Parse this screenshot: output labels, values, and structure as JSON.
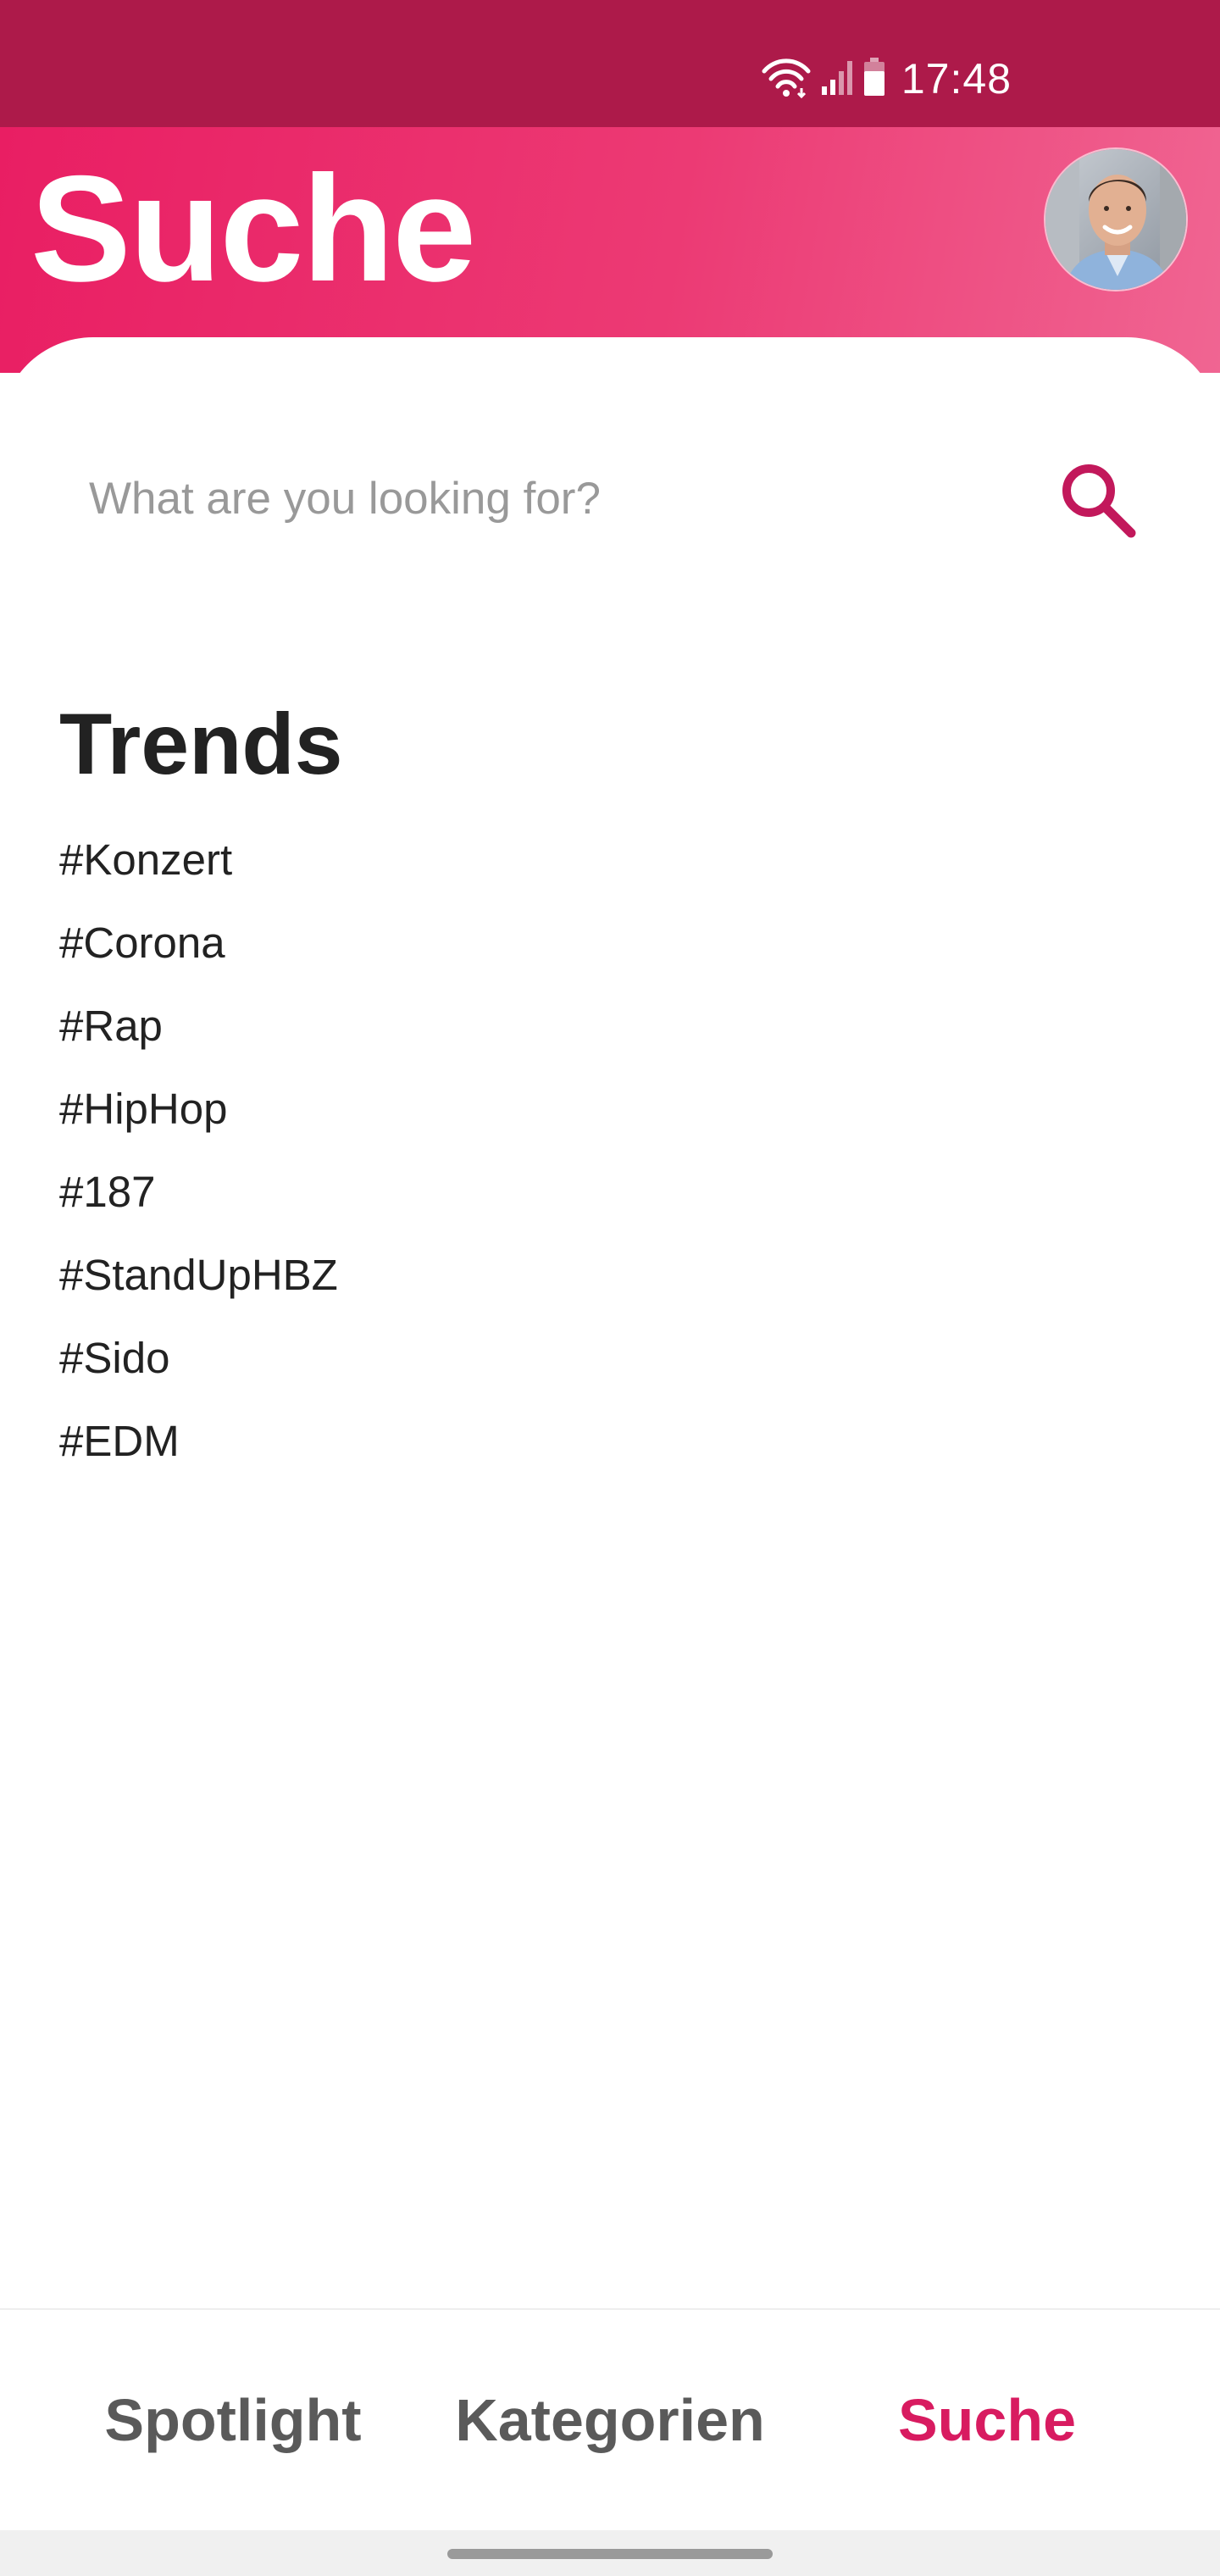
{
  "status_bar": {
    "time": "17:48",
    "icons": [
      "wifi-icon",
      "signal-icon",
      "battery-icon"
    ],
    "background": "#ad1a4a"
  },
  "header": {
    "title": "Suche",
    "avatar_icon": "user-avatar",
    "gradient_start": "#e91e63",
    "gradient_end": "#f06592"
  },
  "search": {
    "placeholder": "What are you looking for?",
    "value": "",
    "icon": "search-icon"
  },
  "trends": {
    "title": "Trends",
    "items": [
      "#Konzert",
      "#Corona",
      "#Rap",
      "#HipHop",
      "#187",
      "#StandUpHBZ",
      "#Sido",
      "#EDM"
    ]
  },
  "bottom_nav": {
    "tabs": [
      {
        "label": "Spotlight",
        "active": false
      },
      {
        "label": "Kategorien",
        "active": false
      },
      {
        "label": "Suche",
        "active": true
      }
    ],
    "active_color": "#d81b60",
    "inactive_color": "#5a5a5a"
  }
}
